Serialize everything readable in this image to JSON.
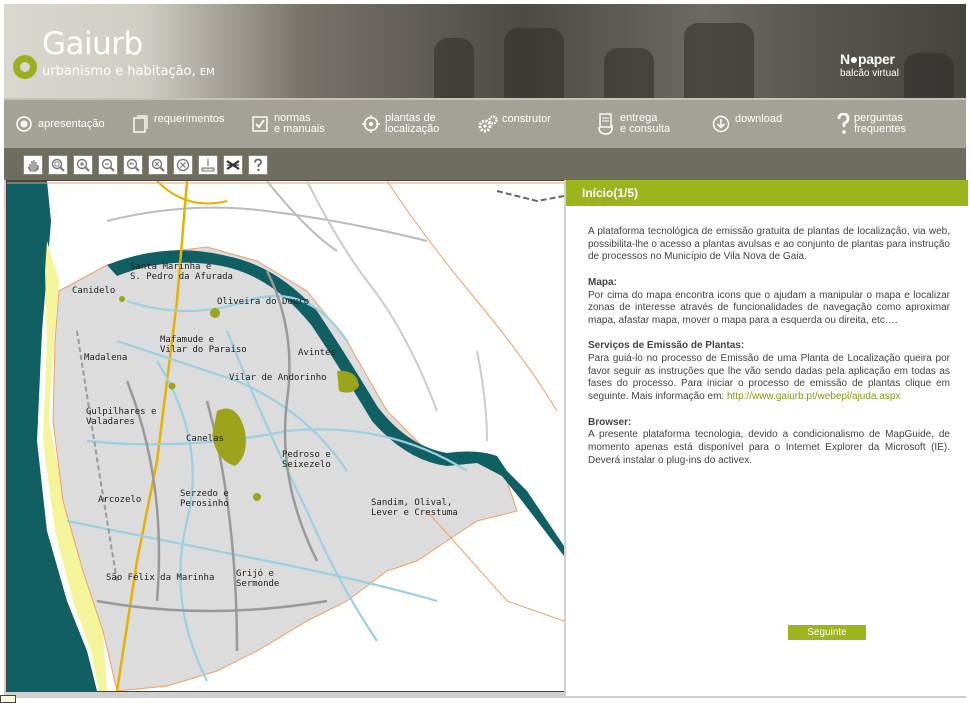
{
  "header": {
    "brand_title": "Gaiurb",
    "brand_subtitle": "urbanismo e habitação,",
    "brand_suffix": "EM",
    "partner_title": "N●paper",
    "partner_subtitle": "balcão virtual"
  },
  "nav": {
    "items": [
      {
        "label": "apresentação",
        "icon": "radio-icon"
      },
      {
        "label": "requerimentos",
        "icon": "document-icon"
      },
      {
        "label": "normas\ne manuais",
        "icon": "checkbox-icon"
      },
      {
        "label": "plantas de\nlocalização",
        "icon": "crosshair-icon"
      },
      {
        "label": "construtor",
        "icon": "gears-icon"
      },
      {
        "label": "entrega\ne consulta",
        "icon": "hand-document-icon"
      },
      {
        "label": "download",
        "icon": "download-icon"
      },
      {
        "label": "perguntas\nfrequentes",
        "icon": "question-icon"
      }
    ]
  },
  "toolbar": {
    "tools": [
      "pan-icon",
      "zoom-rectangle-icon",
      "zoom-in-icon",
      "zoom-out-icon",
      "zoom-previous-icon",
      "zoom-full-icon",
      "clear-icon",
      "measure-icon",
      "select-icon",
      "help-icon"
    ]
  },
  "map": {
    "labels": [
      "Santa Marinha e\nS. Pedro da Afurada",
      "Canidelo",
      "Oliveira do Douro",
      "Mafamude e\nVilar do Paraíso",
      "Madalena",
      "Avintes",
      "Vilar de Andorinho",
      "Gulpilhares e\nValadares",
      "Canelas",
      "Pedroso e\nSeixezelo",
      "Arcozelo",
      "Serzedo e\nPerosinho",
      "Sandim, Olival,\nLever e Crestuma",
      "São Félix da Marinha",
      "Grijó e\nSermonde"
    ]
  },
  "panel": {
    "title": "Início(1/5)",
    "intro": "A plataforma tecnológica de emissão gratuita de plantas de localização, via web, possibilita-lhe o acesso a plantas avulsas e ao conjunto de plantas para instrução de processos no Município de Vila Nova de Gaia.",
    "map_heading": "Mapa:",
    "map_text": "Por cima do mapa encontra icons que o ajudam a manipular o mapa e localizar zonas de interesse através de funcionalidades de navegação como aproximar mapa, afastar mapa, mover o mapa para a esquerda ou direita, etc….",
    "services_heading": "Serviços de Emissão de Plantas:",
    "services_text": "Para guiá-lo no processo de Emissão de uma Planta de Localização queira por favor seguir as instruções que lhe vão sendo dadas pela aplicação em todas as fases do processo. Para iniciar o processo de emissão de plantas clique em seguinte. Mais informação em:",
    "services_link": "http://www.gaiurb.pt/webepl/ajuda.aspx",
    "browser_heading": "Browser:",
    "browser_text": "A presente plataforma tecnologia, devido a condicionalismo de MapGuide, de momento apenas está disponível para o Internet Explorer da Microsoft (IE). Deverá instalar o plug-ins do activex.",
    "next_label": "Seguinte"
  },
  "colors": {
    "accent": "#9cb51c",
    "nav_bg": "#a4a296",
    "toolbar_bg": "#6f6d5d",
    "river": "#0f5f63",
    "land": "#dcdcdc"
  }
}
